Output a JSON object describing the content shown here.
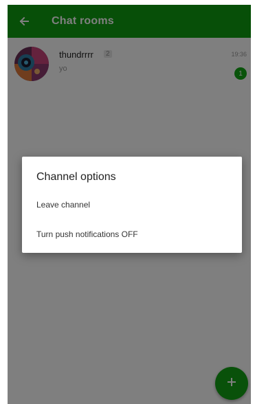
{
  "app_bar": {
    "title": "Chat rooms",
    "back_icon": "arrow-back-icon",
    "color": "#0f9e10"
  },
  "rooms": [
    {
      "name": "thundrrrr",
      "member_count": "2",
      "last_message": "yo",
      "time": "19:36",
      "unread": "1",
      "avatar_icon": "avatar-image"
    }
  ],
  "fab": {
    "icon": "plus-icon",
    "color": "#13a315"
  },
  "dialog": {
    "title": "Channel options",
    "options": [
      {
        "label": "Leave channel"
      },
      {
        "label": "Turn push notifications OFF"
      }
    ]
  },
  "colors": {
    "accent": "#0f9e10",
    "badge": "#12a614"
  }
}
